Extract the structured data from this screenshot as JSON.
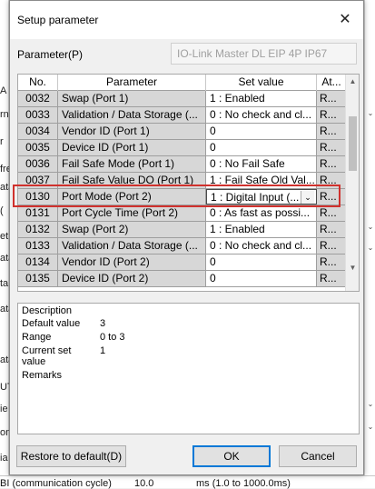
{
  "background": {
    "left_fragments": [
      "A",
      "rn",
      "r",
      "fre",
      "ata",
      "(",
      "et",
      "ata",
      "ta",
      "ata",
      "ata",
      "UT",
      "ie",
      "on",
      "ia"
    ],
    "bottom_label": "BI (communication cycle)",
    "bottom_value": "10.0",
    "bottom_unit": "ms   (1.0 to 1000.0ms)"
  },
  "dialog": {
    "title": "Setup parameter",
    "close_glyph": "✕",
    "parameter_label": "Parameter(P)",
    "device_name": "IO-Link Master DL EIP 4P IP67"
  },
  "grid": {
    "columns": [
      "No.",
      "Parameter",
      "Set value",
      "At..."
    ],
    "rows": [
      {
        "no": "0032",
        "param": "Swap (Port 1)",
        "value": "1 : Enabled",
        "attr": "R..."
      },
      {
        "no": "0033",
        "param": "Validation / Data Storage (...",
        "value": "0 : No check and cl...",
        "attr": "R..."
      },
      {
        "no": "0034",
        "param": "Vendor ID (Port 1)",
        "value": "0",
        "attr": "R..."
      },
      {
        "no": "0035",
        "param": "Device ID (Port 1)",
        "value": "0",
        "attr": "R..."
      },
      {
        "no": "0036",
        "param": "Fail Safe Mode (Port 1)",
        "value": "0 : No Fail Safe",
        "attr": "R..."
      },
      {
        "no": "0037",
        "param": "Fail Safe Value DO (Port 1)",
        "value": "1 : Fail Safe Old Val...",
        "attr": "R..."
      },
      {
        "no": "0130",
        "param": "Port Mode (Port 2)",
        "value": "1 : Digital Input (...",
        "attr": "R...",
        "selected": true
      },
      {
        "no": "0131",
        "param": "Port Cycle Time (Port 2)",
        "value": "0 : As fast as possi...",
        "attr": "R..."
      },
      {
        "no": "0132",
        "param": "Swap (Port 2)",
        "value": "1 : Enabled",
        "attr": "R..."
      },
      {
        "no": "0133",
        "param": "Validation / Data Storage (...",
        "value": "0 : No check and cl...",
        "attr": "R..."
      },
      {
        "no": "0134",
        "param": "Vendor ID (Port 2)",
        "value": "0",
        "attr": "R..."
      },
      {
        "no": "0135",
        "param": "Device ID (Port 2)",
        "value": "0",
        "attr": "R..."
      }
    ]
  },
  "description": {
    "title": "Description",
    "default_label": "Default value",
    "default_value": "3",
    "range_label": "Range",
    "range_value": "0 to 3",
    "current_label_1": "Current set",
    "current_label_2": "value",
    "current_value": "1",
    "remarks_label": "Remarks"
  },
  "buttons": {
    "restore": "Restore to default(D)",
    "ok": "OK",
    "cancel": "Cancel"
  },
  "colors": {
    "highlight": "#d0312d",
    "default_button_border": "#0078d7",
    "readonly_cell": "#d7d7d7"
  }
}
